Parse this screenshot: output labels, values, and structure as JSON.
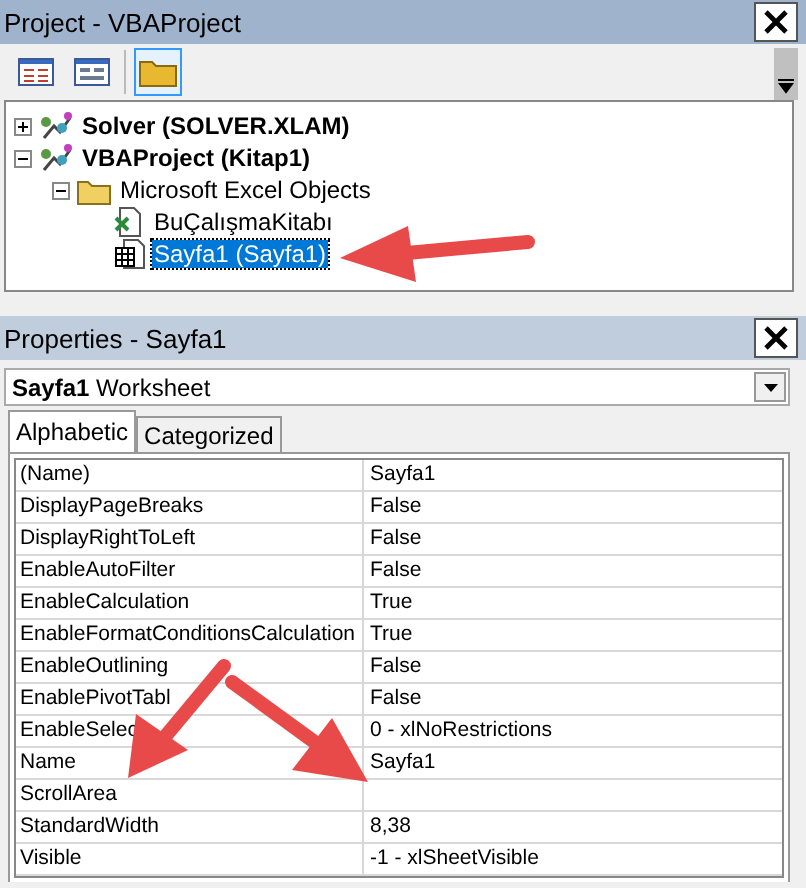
{
  "project": {
    "title": "Project - VBAProject",
    "toolbar": [
      {
        "kind": "code",
        "selected": false
      },
      {
        "kind": "form",
        "selected": false
      },
      {
        "kind": "folder",
        "selected": true
      }
    ],
    "tree": [
      {
        "label": "Solver (SOLVER.XLAM)",
        "kind": "project",
        "expanded": false,
        "selected": false
      },
      {
        "label": "VBAProject (Kitap1)",
        "kind": "project",
        "expanded": true,
        "selected": false,
        "children": [
          {
            "label": "Microsoft Excel Objects",
            "kind": "folder",
            "expanded": true,
            "selected": false,
            "children": [
              {
                "label": "BuÇalışmaKitabı",
                "kind": "workbook",
                "selected": false
              },
              {
                "label": "Sayfa1 (Sayfa1)",
                "kind": "sheet",
                "selected": true
              }
            ]
          }
        ]
      }
    ]
  },
  "properties": {
    "title": "Properties - Sayfa1",
    "object": {
      "name": "Sayfa1",
      "type": "Worksheet"
    },
    "tabs": [
      {
        "label": "Alphabetic",
        "selected": true
      },
      {
        "label": "Categorized",
        "selected": false
      }
    ],
    "rows": [
      {
        "name": "(Name)",
        "value": "Sayfa1"
      },
      {
        "name": "DisplayPageBreaks",
        "value": "False"
      },
      {
        "name": "DisplayRightToLeft",
        "value": "False"
      },
      {
        "name": "EnableAutoFilter",
        "value": "False"
      },
      {
        "name": "EnableCalculation",
        "value": "True"
      },
      {
        "name": "EnableFormatConditionsCalculation",
        "value": "True"
      },
      {
        "name": "EnableOutlining",
        "value": "False"
      },
      {
        "name": "EnablePivotTabl",
        "value": "False"
      },
      {
        "name": "EnableSelec",
        "value": "0 - xlNoRestrictions"
      },
      {
        "name": "Name",
        "value": "Sayfa1"
      },
      {
        "name": "ScrollArea"
      },
      {
        "name": "StandardWidth",
        "value": "8,38"
      },
      {
        "name": "Visible",
        "value": "-1 - xlSheetVisible"
      }
    ]
  }
}
